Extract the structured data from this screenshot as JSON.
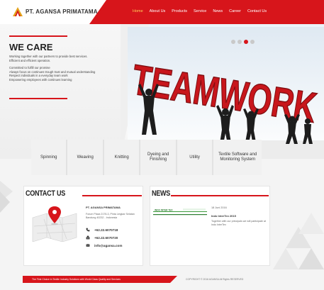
{
  "brand": {
    "name": "PT. AGANSA PRIMATAMA",
    "accent": "#d7151b"
  },
  "nav": {
    "items": [
      "Home",
      "About Us",
      "Products",
      "Service",
      "News",
      "Career",
      "Contact Us"
    ],
    "active": "Home"
  },
  "hero": {
    "title": "WE CARE",
    "paragraphs": [
      "Working together with our partners to provide best services.\nEfficient and efficient operation.",
      "Committed to fulfill our promise\nAlways focus on continues trough trust and mutual understanding\nRespect individuals in a everyday team work\nEmpowering employees with continues learning"
    ],
    "image_word": "TEAMWORK",
    "slider_active_index": 2,
    "slider_count": 4
  },
  "services": [
    "Spinning",
    "Weaving",
    "Knitting",
    "Dyeing and Finishing",
    "Utility",
    "Textile Software and Monitoring System"
  ],
  "contact": {
    "heading": "CONTACT US",
    "company": "PT. AGANSA PRIMATAMA",
    "address": "Forum Plaza 2176-3, Pinta Lingkar Selatan\nBandung 40232 - Indonesia",
    "phone": "+62.22.6070718",
    "fax": "+62.22.6070720",
    "email": "info@agansa.com",
    "icons": [
      "phone-icon",
      "fax-icon",
      "email-icon",
      "map-pin-icon"
    ]
  },
  "news": {
    "heading": "NEWS",
    "banner_text": "INDO INTER TEX",
    "date": "18 Juni 2016",
    "title": "Indo InterTex 2015",
    "text": "Together with our principals we will participate at Indo InterTex"
  },
  "footer": {
    "tagline": "The First Choice in Textile Industry Solutions with World Class Quality and Services",
    "copyright": "COPYRIGHT © 2016 AGANSA All Rights RESERVED"
  }
}
